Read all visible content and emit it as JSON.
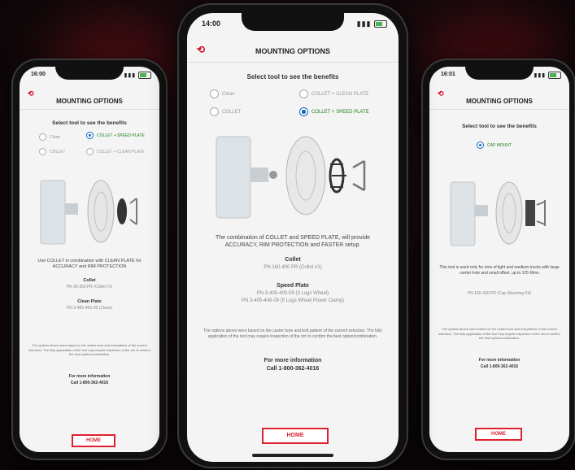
{
  "center": {
    "time": "14:00",
    "title": "MOUNTING OPTIONS",
    "subtitle": "Select tool to see the benefits",
    "options": [
      {
        "label": "Clean",
        "selected": false
      },
      {
        "label": "COLLET + CLEAN PLATE",
        "selected": false
      },
      {
        "label": "COLLET",
        "selected": false
      },
      {
        "label": "COLLET + SPEED PLATE",
        "selected": true
      }
    ],
    "description": "The combination of COLLET and SPEED PLATE, will provide ACCURACY, RIM PROTECTION and FASTER setup.",
    "collet_label": "Collet",
    "collet_value": "PN 160-400 PR (Collet #1)",
    "speed_label": "Speed Plate",
    "speed_values": [
      "PN 3-405-400-09 (3 Lugs Wheel)",
      "PN 3-405-406-09 (5 Lugs Wheel Power Clamp)"
    ],
    "note": "The options above were based on the caster bore and bolt pattern of the current selection. The fully application of the tool may require inspection of the rim to confirm the best option/combination.",
    "info_label": "For more information",
    "info_phone": "Call 1-800-362-4016",
    "home_label": "HOME"
  },
  "left": {
    "time": "16:00",
    "title": "MOUNTING OPTIONS",
    "subtitle": "Select tool to see the benefits",
    "options": [
      {
        "label": "Clean",
        "selected": false
      },
      {
        "label": "COLLET + SPEED PLATE",
        "selected": true
      },
      {
        "label": "COLLET",
        "selected": false
      },
      {
        "label": "COLLET + CLEAN PLATE",
        "selected": false
      }
    ],
    "description": "Use COLLET in combination with CLEAN PLATE for ACCURACY and RIM PROTECTION",
    "collet_label": "Collet",
    "collet_value": "PN 30-350 PR (Collet #1)",
    "plate_label": "Clean Plate",
    "plate_value": "PN 3-405-406-09 (Clean)",
    "note": "The options above were based on the caster bore and bolt pattern of the current selection. The fully application of the tool may require inspection of the rim to confirm the best option/combination.",
    "info_label": "For more information",
    "info_phone": "Call 1-800-362-4016",
    "home_label": "HOME"
  },
  "right": {
    "time": "16:01",
    "title": "MOUNTING OPTIONS",
    "subtitle": "Select tool to see the benefits",
    "options": [
      {
        "label": "CAP MOUNT",
        "selected": true
      }
    ],
    "description": "This tool is used only for rims of light and medium trucks with large center hole and small offset, up to 125 Rims",
    "collet_value": "PN 160-400 PR (Cap Mounting Kit)",
    "note": "The options above were based on the caster bore and bolt pattern of the current selection. The fully application of the tool may require inspection of the rim to confirm the best option/combination.",
    "info_label": "For more information",
    "info_phone": "Call 1-800-362-4016",
    "home_label": "HOME"
  }
}
